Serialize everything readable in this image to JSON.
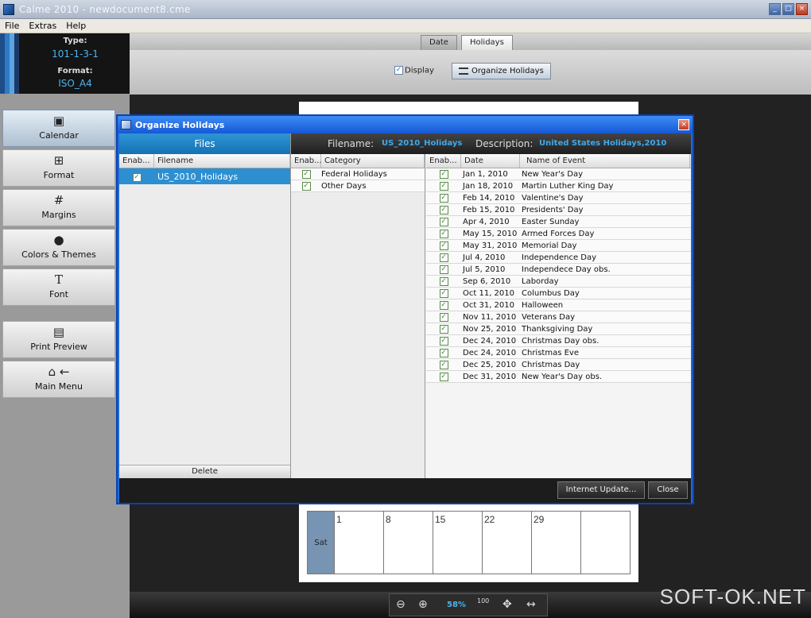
{
  "window": {
    "title": "Calme 2010 - newdocument8.cme"
  },
  "menu": [
    "File",
    "Extras",
    "Help"
  ],
  "typebox": {
    "type_label": "Type:",
    "type_value": "101-1-3-1",
    "format_label": "Format:",
    "format_value": "ISO_A4"
  },
  "nav": {
    "calendar": "Calendar",
    "format": "Format",
    "margins": "Margins",
    "colors": "Colors & Themes",
    "font": "Font",
    "print_preview": "Print Preview",
    "main_menu": "Main Menu"
  },
  "tabs": {
    "date": "Date",
    "holidays": "Holidays"
  },
  "options": {
    "display": "Display",
    "organize": "Organize Holidays"
  },
  "calendar_row": {
    "day": "Sat",
    "cells": [
      "1",
      "8",
      "15",
      "22",
      "29",
      ""
    ]
  },
  "zoom": {
    "value": "58%",
    "fit_label": "100"
  },
  "watermark": "SOFT-OK.NET",
  "dialog": {
    "title": "Organize Holidays",
    "files_header": "Files",
    "filename_label": "Filename:",
    "filename_value": "US_2010_Holidays",
    "description_label": "Description:",
    "description_value": "United States Holidays,2010",
    "files_cols": [
      "Enab...",
      "Filename"
    ],
    "files": [
      "US_2010_Holidays"
    ],
    "delete": "Delete",
    "cat_cols": [
      "Enab...",
      "Category"
    ],
    "categories": [
      "Federal Holidays",
      "Other Days"
    ],
    "ev_cols": [
      "Enab...",
      "Date",
      "Name of Event"
    ],
    "events": [
      {
        "date": "Jan 1, 2010",
        "name": "New Year's Day"
      },
      {
        "date": "Jan 18, 2010",
        "name": "Martin Luther King Day"
      },
      {
        "date": "Feb 14, 2010",
        "name": "Valentine's Day"
      },
      {
        "date": "Feb 15, 2010",
        "name": "Presidents' Day"
      },
      {
        "date": "Apr 4, 2010",
        "name": "Easter Sunday"
      },
      {
        "date": "May 15, 2010",
        "name": "Armed Forces Day"
      },
      {
        "date": "May 31, 2010",
        "name": "Memorial Day"
      },
      {
        "date": "Jul 4, 2010",
        "name": "Independence Day"
      },
      {
        "date": "Jul 5, 2010",
        "name": "Independece Day obs."
      },
      {
        "date": "Sep 6, 2010",
        "name": "Laborday"
      },
      {
        "date": "Oct 11, 2010",
        "name": "Columbus Day"
      },
      {
        "date": "Oct 31, 2010",
        "name": "Halloween"
      },
      {
        "date": "Nov 11, 2010",
        "name": "Veterans Day"
      },
      {
        "date": "Nov 25, 2010",
        "name": "Thanksgiving Day"
      },
      {
        "date": "Dec 24, 2010",
        "name": "Christmas Day obs."
      },
      {
        "date": "Dec 24, 2010",
        "name": "Christmas Eve"
      },
      {
        "date": "Dec 25, 2010",
        "name": "Christmas Day"
      },
      {
        "date": "Dec 31, 2010",
        "name": "New Year's Day obs."
      }
    ],
    "internet_update": "Internet Update...",
    "close": "Close"
  }
}
